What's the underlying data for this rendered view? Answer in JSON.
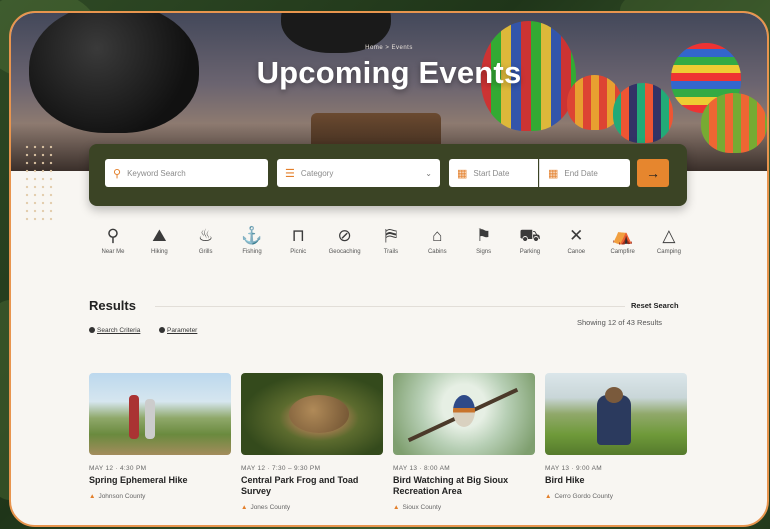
{
  "hero": {
    "breadcrumb": "Home > Events",
    "title": "Upcoming Events"
  },
  "search": {
    "keyword_placeholder": "Keyword Search",
    "category_value": "Category",
    "start_date_placeholder": "Start Date",
    "end_date_placeholder": "End Date",
    "submit_icon": "arrow-right-icon"
  },
  "categories": [
    {
      "label": "Near Me",
      "icon": "map-pin-icon",
      "glyph": "⚲"
    },
    {
      "label": "Hiking",
      "icon": "hiking-icon",
      "glyph": "⛰"
    },
    {
      "label": "Grills",
      "icon": "grill-icon",
      "glyph": "♨"
    },
    {
      "label": "Fishing",
      "icon": "fishing-icon",
      "glyph": "⚓"
    },
    {
      "label": "Picnic",
      "icon": "picnic-table-icon",
      "glyph": "⊓"
    },
    {
      "label": "Geocaching",
      "icon": "compass-icon",
      "glyph": "⊘"
    },
    {
      "label": "Trails",
      "icon": "trail-map-icon",
      "glyph": "⛿"
    },
    {
      "label": "Cabins",
      "icon": "cabin-icon",
      "glyph": "⌂"
    },
    {
      "label": "Signs",
      "icon": "sign-icon",
      "glyph": "⚑"
    },
    {
      "label": "Parking",
      "icon": "parking-icon",
      "glyph": "⛟"
    },
    {
      "label": "Canoe",
      "icon": "canoe-icon",
      "glyph": "✕"
    },
    {
      "label": "Campfire",
      "icon": "campfire-icon",
      "glyph": "⛺"
    },
    {
      "label": "Camping",
      "icon": "tent-icon",
      "glyph": "△"
    }
  ],
  "results": {
    "title": "Results",
    "reset_label": "Reset Search",
    "showing_text": "Showing 12 of 43 Results",
    "links": [
      "Search Criteria",
      "Parameter"
    ]
  },
  "events": [
    {
      "date": "MAY 12 · 4:30 PM",
      "title": "Spring Ephemeral Hike",
      "location": "Johnson County"
    },
    {
      "date": "MAY 12 · 7:30 – 9:30 PM",
      "title": "Central Park Frog and Toad Survey",
      "location": "Jones County"
    },
    {
      "date": "MAY 13 · 8:00 AM",
      "title": "Bird Watching at Big Sioux Recreation Area",
      "location": "Sioux County"
    },
    {
      "date": "MAY 13 · 9:00 AM",
      "title": "Bird Hike",
      "location": "Cerro Gordo County"
    }
  ],
  "colors": {
    "accent": "#e6862e",
    "searchbar_bg": "#3b4425",
    "frame_border": "#e8954e",
    "page_bg": "#f8f6f2"
  }
}
